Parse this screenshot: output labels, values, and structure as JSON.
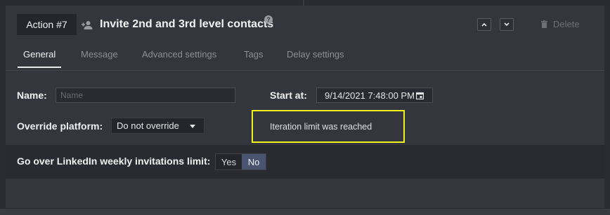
{
  "action": {
    "badge": "Action #7",
    "title": "Invite 2nd and 3rd level contacts",
    "help_glyph": "?",
    "delete_label": "Delete"
  },
  "tabs": [
    {
      "label": "General",
      "active": true
    },
    {
      "label": "Message",
      "active": false
    },
    {
      "label": "Advanced settings",
      "active": false
    },
    {
      "label": "Tags",
      "active": false
    },
    {
      "label": "Delay settings",
      "active": false
    }
  ],
  "form": {
    "name_label": "Name:",
    "name_placeholder": "Name",
    "name_value": "",
    "start_label": "Start at:",
    "start_value": "9/14/2021 7:48:00 PM",
    "override_label": "Override platform:",
    "override_value": "Do not override",
    "iteration_message": "Iteration limit was reached",
    "linkedin_label": "Go over LinkedIn weekly invitations limit:",
    "toggle_yes": "Yes",
    "toggle_no": "No",
    "toggle_selected": "No"
  },
  "icons": {
    "person": "add-person-icon",
    "help": "help-icon",
    "up": "chevron-up-icon",
    "down": "chevron-down-icon",
    "trash": "trash-icon",
    "calendar": "calendar-icon",
    "caret": "caret-down-icon"
  },
  "colors": {
    "highlight": "#f4f21c",
    "toggle_active": "#485470",
    "panel": "#34363e",
    "band": "#2a2b31"
  }
}
